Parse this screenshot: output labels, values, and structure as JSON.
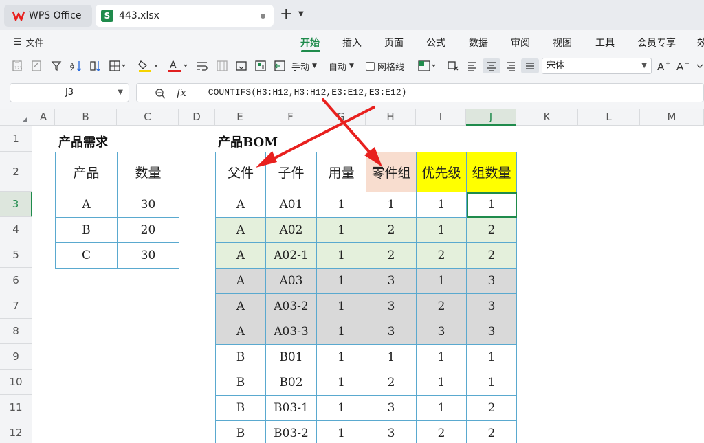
{
  "tabs": {
    "home_label": "WPS Office",
    "file_label": "443.xlsx",
    "file_logo_letter": "S"
  },
  "menu": {
    "file_label": "文件",
    "items": [
      "开始",
      "插入",
      "页面",
      "公式",
      "数据",
      "审阅",
      "视图",
      "工具",
      "会员专享",
      "效"
    ]
  },
  "toolbar": {
    "wrap_mode": "手动",
    "auto_label": "自动",
    "gridlines_label": "网格线",
    "font_name": "宋体",
    "font_color": "#e02020",
    "fill_color": "#f5d300"
  },
  "formula_bar": {
    "cell_ref": "J3",
    "fx": "fx",
    "formula": "=COUNTIFS(H3:H12,H3:H12,E3:E12,E3:E12)"
  },
  "sheet": {
    "columns": [
      "A",
      "B",
      "C",
      "D",
      "E",
      "F",
      "G",
      "H",
      "I",
      "J",
      "K",
      "L",
      "M"
    ],
    "selected_column": "J",
    "rows": [
      "1",
      "2",
      "3",
      "4",
      "5",
      "6",
      "7",
      "8",
      "9",
      "10",
      "11",
      "12"
    ],
    "selected_row": "3",
    "demand_title": "产品需求",
    "demand_headers": [
      "产品",
      "数量"
    ],
    "demand_rows": [
      [
        "A",
        "30"
      ],
      [
        "B",
        "20"
      ],
      [
        "C",
        "30"
      ]
    ],
    "bom_title": "产品BOM",
    "bom_headers": [
      "父件",
      "子件",
      "用量",
      "零件组",
      "优先级",
      "组数量"
    ],
    "bom_rows": [
      [
        "A",
        "A01",
        "1",
        "1",
        "1",
        "1"
      ],
      [
        "A",
        "A02",
        "1",
        "2",
        "1",
        "2"
      ],
      [
        "A",
        "A02-1",
        "1",
        "2",
        "2",
        "2"
      ],
      [
        "A",
        "A03",
        "1",
        "3",
        "1",
        "3"
      ],
      [
        "A",
        "A03-2",
        "1",
        "3",
        "2",
        "3"
      ],
      [
        "A",
        "A03-3",
        "1",
        "3",
        "3",
        "3"
      ],
      [
        "B",
        "B01",
        "1",
        "1",
        "1",
        "1"
      ],
      [
        "B",
        "B02",
        "1",
        "2",
        "1",
        "1"
      ],
      [
        "B",
        "B03-1",
        "1",
        "3",
        "1",
        "2"
      ],
      [
        "B",
        "B03-2",
        "1",
        "3",
        "2",
        "2"
      ]
    ],
    "colors": {
      "group_green": "#e4f0dc",
      "group_gray": "#d9d9d9",
      "header_orange": "#f8ddcf",
      "header_yellow": "#ffff00",
      "arrow_red": "#e8201e",
      "accent_green": "#1f8b4c"
    }
  }
}
